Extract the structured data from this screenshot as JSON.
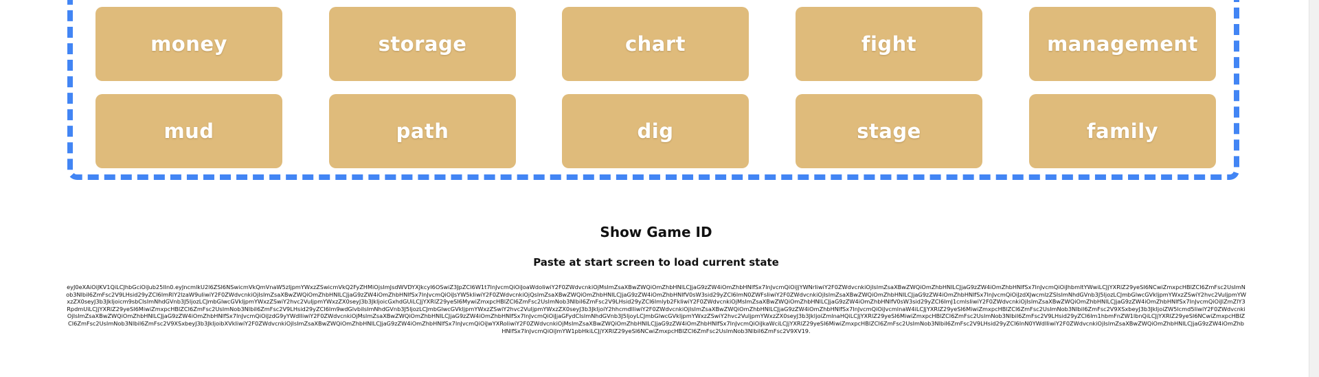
{
  "tiles": [
    "money",
    "storage",
    "chart",
    "fight",
    "management",
    "mud",
    "path",
    "dig",
    "stage",
    "family"
  ],
  "game_id_section": {
    "title": "Show Game ID",
    "subtitle": "Paste at start screen to load current state",
    "game_id": "eyJ0eXAiOiJKV1QiLCJhbGciOiJub25lIn0.eyJncmlkU2l6ZSI6NSwicmVkQmVnaW5zIjpmYWxzZSwicmVkQ2FyZHMiOjsImJsdWVDYXJkcyI6OSwiZ3JpZCI6W1t7InJvcmQiOiJoaWdoIiwiY2F0ZWdvcnkiOjMsImZsaXBwZWQiOmZhbHNlLCJjaG9zZW4iOmZhbHNlfSx7InJvcmQiOiJjYWNrIiwiY2F0ZWdvcnkiOjIsImZsaXBwZWQiOmZhbHNlLCJjaG9zZW4iOmZhbHNlfSx7InJvcmQiOiJhbmltYWwiLCJjYXRlZ29yeSI6NCwiZmxpcHBlZCI6ZmFsc2UsImNob3NlbiI6ZmFsc2V9LHsid29yZCI6ImRlY2lzaW9uIiwiY2F0ZWdvcnkiOjIsImZsaXBwZWQiOmZhbHNlLCJjaG9zZW4iOmZhbHNlfSx7InJvcmQiOiJsYW5kIiwiY2F0ZWdvcnkiOjQsImZsaXBwZWQiOmZhbHNlLCJjaG9zZW4iOmZhbHNlfV0sW3sid29yZCI6ImN0ZWFsIiwiY2F0ZWdvcnkiOjIsImZsaXBwZWQiOmZhbHNlLCJjaG9zZW4iOmZhbHNlfSx7InJvcmQiOiJzdXJwcmlzZSIsImNhdGVnb3J5IjozLCJmbGlwcGVkIjpmYWxzZSwiY2hvc2VuIjpmYWxzZX0seyJ3b3JkIjoicm9sbCIsImNhdGVnb3J5IjozLCJmbGlwcGVkIjpmYWxzZSwiY2hvc2VuIjpmYWxzZX0seyJ3b3JkIjoicGxhdGUiLCJjYXRlZ29yeSI6MywiZmxpcHBlZCI6ZmFsc2UsImNob3NlbiI6ZmFsc2V9LHsid29yZCI6Imlyb2FkIiwiY2F0ZWdvcnkiOjMsImZsaXBwZWQiOmZhbHNlLCJjaG9zZW4iOmZhbHNlfV0sW3sid29yZCI6ImJ1cmlsIiwiY2F0ZWdvcnkiOjIsImZsaXBwZWQiOmZhbHNlLCJjaG9zZW4iOmZhbHNlfSx7InJvcmQiOiJlZmZlY3RpdmUiLCJjYXRlZ29yeSI6MiwiZmxpcHBlZCI6ZmFsc2UsImNob3NlbiI6ZmFsc2V9LHsid29yZCI6Im9wdGlvbiIsImNhdGVnb3J5IjozLCJmbGlwcGVkIjpmYWxzZSwiY2hvc2VuIjpmYWxzZX0seyJ3b3JkIjoiY2hhcmdlIiwiY2F0ZWdvcnkiOjIsImZsaXBwZWQiOmZhbHNlLCJjaG9zZW4iOmZhbHNlfSx7InJvcmQiOiJvcmlnaW4iLCJjYXRlZ29yeSI6MiwiZmxpcHBlZCI6ZmFsc2UsImNob3NlbiI6ZmFsc2V9XSxbeyJ3b3JkIjoiZW5lcmd5IiwiY2F0ZWdvcnkiOjIsImZsaXBwZWQiOmZhbHNlLCJjaG9zZW4iOmZhbHNlfSx7InJvcmQiOiJzdG9yYWdlIiwiY2F0ZWdvcnkiOjMsImZsaXBwZWQiOmZhbHNlLCJjaG9zZW4iOmZhbHNlfSx7InJvcmQiOiJjaGFydCIsImNhdGVnb3J5IjoyLCJmbGlwcGVkIjpmYWxzZSwiY2hvc2VuIjpmYWxzZX0seyJ3b3JkIjoiZmlnaHQiLCJjYXRlZ29yeSI6MiwiZmxpcHBlZCI6ZmFsc2UsImNob3NlbiI6ZmFsc2V9LHsid29yZCI6Im1hbmFnZW1lbnQiLCJjYXRlZ29yeSI6NCwiZmxpcHBlZCI6ZmFsc2UsImNob3NlbiI6ZmFsc2V9XSxbeyJ3b3JkIjoibXVkIiwiY2F0ZWdvcnkiOjIsImZsaXBwZWQiOmZhbHNlLCJjaG9zZW4iOmZhbHNlfSx7InJvcmQiOiJwYXRoIiwiY2F0ZWdvcnkiOjMsImZsaXBwZWQiOmZhbHNlLCJjaG9zZW4iOmZhbHNlfSx7InJvcmQiOiJkaWciLCJjYXRlZ29yeSI6MiwiZmxpcHBlZCI6ZmFsc2UsImNob3NlbiI6ZmFsc2V9LHsid29yZCI6InN0YWdlIiwiY2F0ZWdvcnkiOjIsImZsaXBwZWQiOmZhbHNlLCJjaG9zZW4iOmZhbHNlfSx7InJvcmQiOiJmYW1pbHkiLCJjYXRlZ29yeSI6NCwiZmxpcHBlZCI6ZmFsc2UsImNob3NlbiI6ZmFsc2V9XV19."
  },
  "colors": {
    "tile": "#dfbb7b",
    "tile_text": "#ffffff",
    "board_border": "#4285f4"
  }
}
